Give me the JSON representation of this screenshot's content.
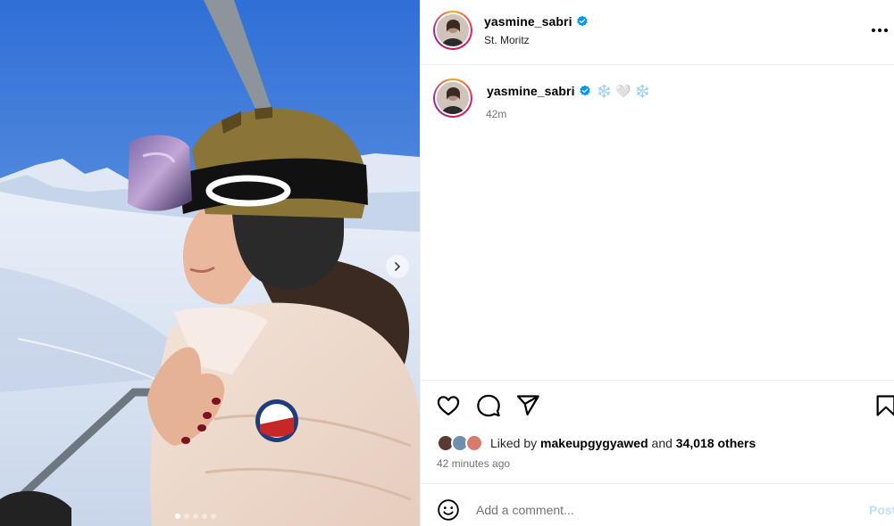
{
  "post": {
    "username": "yasmine_sabri",
    "location": "St. Moritz",
    "caption": "❄️ 🤍 ❄️",
    "caption_time": "42m",
    "liked_by_prefix": "Liked by",
    "liked_by_user": "makeupgygyawed",
    "liked_by_and": "and",
    "others_count": "34,018 others",
    "time_ago": "42 minutes ago"
  },
  "comment": {
    "placeholder": "Add a comment...",
    "post_label": "Post"
  },
  "icons": {
    "verified": "verified-badge-icon",
    "more": "more-options-icon",
    "like": "heart-icon",
    "comment": "comment-bubble-icon",
    "share": "paper-plane-icon",
    "save": "bookmark-icon",
    "emoji": "smiley-icon",
    "next": "chevron-right-icon"
  },
  "media": {
    "slide_count": 5,
    "active_slide": 1
  },
  "colors": {
    "verified_blue": "#0095f6",
    "post_button_disabled": "#c0dffd",
    "secondary_text": "#737373",
    "divider": "#efefef"
  }
}
